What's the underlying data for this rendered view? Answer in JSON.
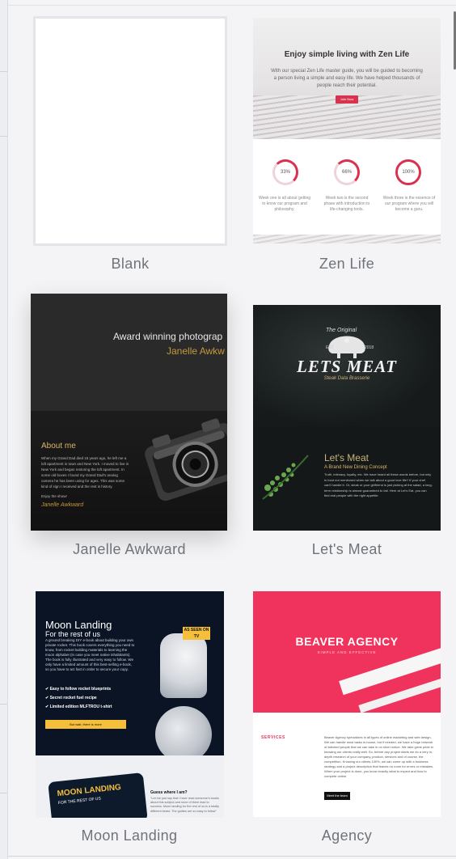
{
  "templates": [
    {
      "id": "blank",
      "label": "Blank"
    },
    {
      "id": "zen_life",
      "label": "Zen Life",
      "preview": {
        "title": "Enjoy simple living with Zen Life",
        "description": "With our special Zen Life master guide, you will be guided to becoming a person living a simple and easy life. We have helped thousands of people reach their potential.",
        "button": "Join Now",
        "stats": [
          {
            "value": "33%",
            "caption": "Week one is all about getting to know our program and philosophy."
          },
          {
            "value": "66%",
            "caption": "Week two is the second phase with introduction to life-changing tools."
          },
          {
            "value": "100%",
            "caption": "Week three is the essence of our program where you will become a guru."
          }
        ]
      }
    },
    {
      "id": "janelle_awkward",
      "label": "Janelle Awkward",
      "preview": {
        "headline": "Award winning photograp",
        "name": "Janelle Awkw",
        "about_title": "About me",
        "about_body": "When my Grand Dad died 15 years ago, he left me a loft apartment in town and New York. I moved to live in New York and began restoring the loft apartment. In some old boxes I found my Grand Dad's analog camera he has been using for ages. This was some kind of sign I received and the rest is history.",
        "enjoy": "Enjoy the show!",
        "signature": "Janelle Awkward"
      }
    },
    {
      "id": "lets_meat",
      "label": "Let's Meat",
      "preview": {
        "tagline": "The Original",
        "est": "EST",
        "year": "2018",
        "brand": "LETS MEAT",
        "subtitle": "Steak Data Brasserie",
        "headline": "Let's Meat",
        "subhead": "A Brand New Dining Concept",
        "body": "Truth, intimacy, loyalty, etc. We have heard all these words before, but why in food not mentioned when we talk about a good love life? If your chef can't handle it. Or, steak or your girlfriend is just picking at the salad, a long-term relationship is almost guaranteed to fail. Here at Let's Eat, you can find real people with the right appetite."
      }
    },
    {
      "id": "moon_landing",
      "label": "Moon Landing",
      "preview": {
        "title": "Moon Landing",
        "subtitle": "For the rest of us",
        "body": "A ground breaking DIY e-book about building your own private rocket. This book covers everything you need to know, from rocket building materials to learning the moon alphabet (in case you meet native inhabitants). The book is fully illustrated and very easy to follow. We only have a limited amount of this best-selling e-book, so you have to act fast in order to secure your copy.",
        "bullets": [
          "Easy to follow rocket blueprints",
          "Secret rocket fuel recipe",
          "Limited edition MLFTROU t-shirt"
        ],
        "button": "But wait, there is more",
        "badge": "AS SEEN ON TV",
        "book_title": "MOON LANDING",
        "book_sub": "FOR THE REST OF US",
        "guess_title": "Guess where I am?",
        "guess_body": "\"Let me just say that I have read someone's books about this subject and none of them lead to success. Moon landing for the rest of us is a totally different beast. The guides are so easy to follow\""
      }
    },
    {
      "id": "agency",
      "label": "Agency",
      "preview": {
        "title": "BEAVER AGENCY",
        "subtitle": "SIMPLE AND EFFECTIVE",
        "section": "SERVICES",
        "body": "Beaver Agency specializes in all types of online marketing and web design. We can handle most tasks in-house, but if needed, we have a huge network of talented people that we can take in on short notice. We take great pride in knowing our clients really well. So, before any project starts we do a very in-depth research of your company, product, services and of course, the competition. Knowing our clients 100%, we can come up with a business strategy and a project description that leaves no room for errors or mistakes. When your project is done, you know exactly what to expect and how to compete online.",
        "button": "Meet the team"
      }
    }
  ]
}
